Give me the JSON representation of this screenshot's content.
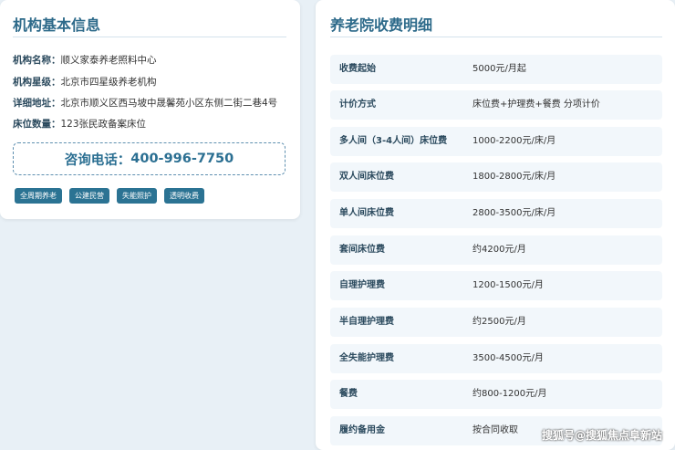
{
  "basic_info": {
    "title": "机构基本信息",
    "rows": [
      {
        "label": "机构名称：",
        "value": "顺义家泰养老照料中心"
      },
      {
        "label": "机构星级：",
        "value": "北京市四星级养老机构"
      },
      {
        "label": "详细地址：",
        "value": "北京市顺义区西马坡中晟馨苑小区东侧二街二巷4号"
      },
      {
        "label": "床位数量：",
        "value": "123张民政备案床位"
      }
    ],
    "phone_label": "咨询电话：",
    "phone_number": "400-996-7750",
    "tags": [
      "全周期养老",
      "公建民营",
      "失能照护",
      "透明收费"
    ]
  },
  "fees": {
    "title": "养老院收费明细",
    "rows": [
      {
        "label": "收费起始",
        "value": "5000元/月起"
      },
      {
        "label": "计价方式",
        "value": "床位费+护理费+餐费 分项计价"
      },
      {
        "label": "多人间（3-4人间）床位费",
        "value": "1000-2200元/床/月"
      },
      {
        "label": "双人间床位费",
        "value": "1800-2800元/床/月"
      },
      {
        "label": "单人间床位费",
        "value": "2800-3500元/床/月"
      },
      {
        "label": "套间床位费",
        "value": "约4200元/月"
      },
      {
        "label": "自理护理费",
        "value": "1200-1500元/月"
      },
      {
        "label": "半自理护理费",
        "value": "约2500元/月"
      },
      {
        "label": "全失能护理费",
        "value": "3500-4500元/月"
      },
      {
        "label": "餐费",
        "value": "约800-1200元/月"
      },
      {
        "label": "履约备用金",
        "value": "按合同收取"
      }
    ]
  },
  "watermark": "搜狐号@搜狐焦点阜新站"
}
